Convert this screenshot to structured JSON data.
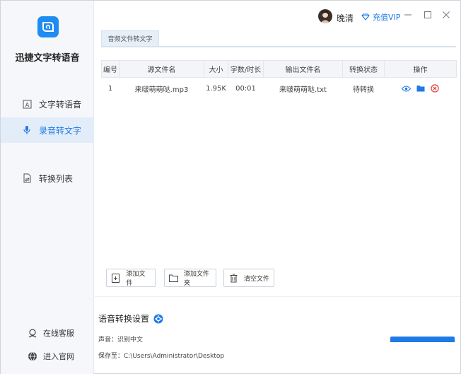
{
  "app": {
    "name": "迅捷文字转语音",
    "user_name": "晚清",
    "vip_label": "充值VIP",
    "accent": "#1e7ae6"
  },
  "sidebar": {
    "items": [
      {
        "label": "文字转语音",
        "icon": "document-a-icon"
      },
      {
        "label": "录音转文字",
        "icon": "microphone-icon"
      },
      {
        "label": "转换列表",
        "icon": "convert-list-icon"
      }
    ],
    "links": [
      {
        "label": "在线客服",
        "icon": "customer-service-icon"
      },
      {
        "label": "进入官网",
        "icon": "globe-icon"
      }
    ]
  },
  "tab": {
    "label": "音频文件转文字"
  },
  "table": {
    "headers": [
      "编号",
      "源文件名",
      "大小",
      "字数/时长",
      "输出文件名",
      "转换状态",
      "操作"
    ],
    "rows": [
      {
        "index": "1",
        "source": "来啵萌萌哒.mp3",
        "size": "1.95K",
        "duration": "00:01",
        "output": "来啵萌萌哒.txt",
        "status": "待转换"
      }
    ]
  },
  "actions": {
    "add_file": "添加文件",
    "add_folder": "添加文件夹",
    "clear_files": "清空文件"
  },
  "settings": {
    "title": "语音转换设置",
    "voice": "声音：识别中文",
    "save_to": "保存至：C:\\Users\\Administrator\\Desktop"
  }
}
